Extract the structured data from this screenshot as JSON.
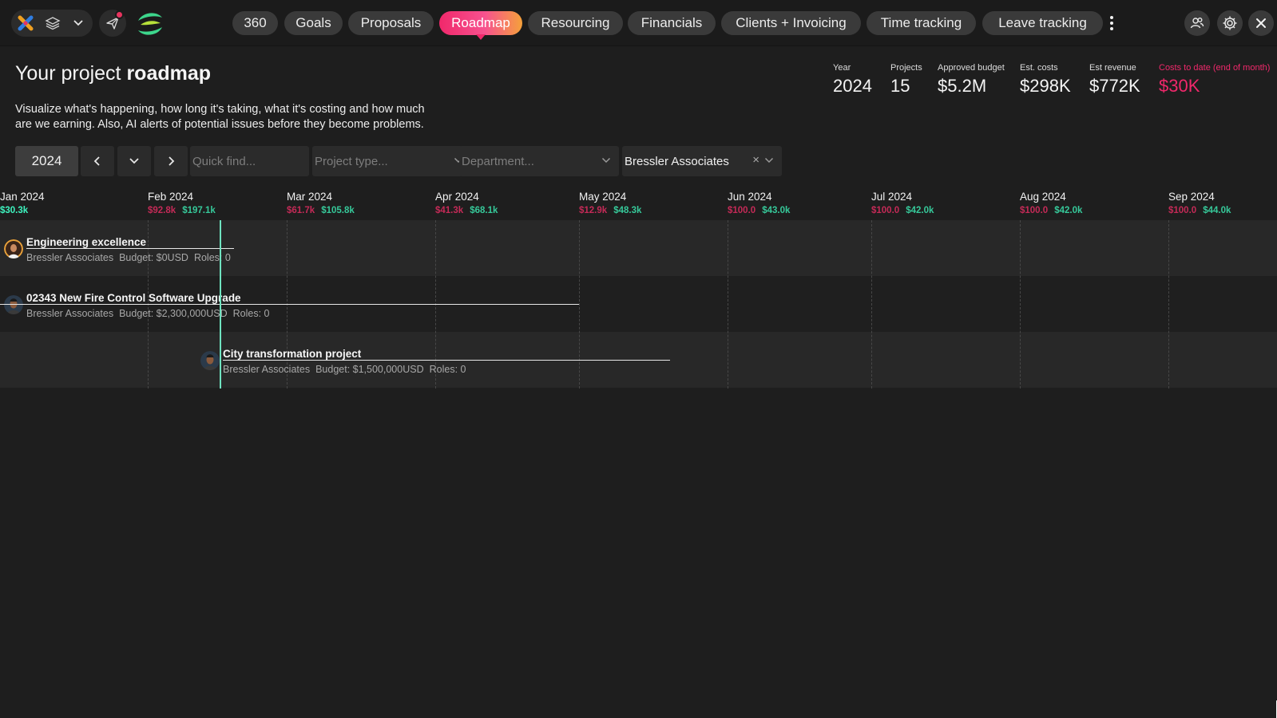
{
  "topbar": {
    "icons": {
      "app": "app-logo-icon",
      "layers": "layers-icon",
      "dropdown": "chevron-down-icon",
      "send": "send-icon",
      "brand": "brand-logo-icon",
      "more": "more-vertical-icon",
      "people": "people-icon",
      "settings": "gear-icon",
      "close": "close-icon"
    },
    "colors": {
      "notification": "#e8345f",
      "active_tab_start": "#f0286b",
      "active_tab_end": "#f5a13a",
      "brand_green": "#3dd68c"
    }
  },
  "nav": {
    "tabs": [
      {
        "label": "360"
      },
      {
        "label": "Goals"
      },
      {
        "label": "Proposals"
      },
      {
        "label": "Roadmap",
        "active": true
      },
      {
        "label": "Resourcing"
      },
      {
        "label": "Financials"
      },
      {
        "label": "Clients + Invoicing"
      },
      {
        "label": "Time tracking"
      },
      {
        "label": "Leave tracking"
      }
    ]
  },
  "header": {
    "title_normal": "Your project",
    "title_bold": "roadmap",
    "subtitle_line1": "Visualize what's happening, how long it's taking, what it's costing and how much",
    "subtitle_line2": "are we earning. Also, AI alerts of potential issues before they become problems."
  },
  "stats": [
    {
      "label": "Year",
      "value": "2024"
    },
    {
      "label": "Projects",
      "value": "15"
    },
    {
      "label": "Approved budget",
      "value": "$5.2M"
    },
    {
      "label": "Est. costs",
      "value": "$298K"
    },
    {
      "label": "Est revenue",
      "value": "$772K"
    },
    {
      "label": "Costs to date (end of month)",
      "value": "$30K"
    }
  ],
  "filters": {
    "year": "2024",
    "quick_find_placeholder": "Quick find...",
    "project_type_placeholder": "Project type...",
    "department_placeholder": "Department...",
    "client": "Bressler Associates",
    "clear_symbol": "×"
  },
  "timeline": {
    "months": [
      {
        "name": "Jan 2024",
        "cost": "",
        "revenue": "$30.3k"
      },
      {
        "name": "Feb 2024",
        "cost": "$92.8k",
        "revenue": "$197.1k"
      },
      {
        "name": "Mar 2024",
        "cost": "$61.7k",
        "revenue": "$105.8k"
      },
      {
        "name": "Apr 2024",
        "cost": "$41.3k",
        "revenue": "$68.1k"
      },
      {
        "name": "May 2024",
        "cost": "$12.9k",
        "revenue": "$48.3k"
      },
      {
        "name": "Jun 2024",
        "cost": "$100.0",
        "revenue": "$43.0k"
      },
      {
        "name": "Jul 2024",
        "cost": "$100.0",
        "revenue": "$42.0k"
      },
      {
        "name": "Aug 2024",
        "cost": "$100.0",
        "revenue": "$42.0k"
      },
      {
        "name": "Sep 2024",
        "cost": "$100.0",
        "revenue": "$44.0k"
      }
    ],
    "colors": {
      "cost": "#c42a57",
      "revenue": "#36c99a",
      "today_line": "#6fe3c0"
    },
    "projects": [
      {
        "name": "Engineering excellence",
        "client": "Bressler Associates",
        "budget": "Budget: $0USD",
        "roles": "Roles: 0",
        "avatar": "avatar-woman"
      },
      {
        "name": "02343 New Fire Control Software Upgrade",
        "client": "Bressler Associates",
        "budget": "Budget: $2,300,000USD",
        "roles": "Roles: 0",
        "avatar": "avatar-man"
      },
      {
        "name": "City transformation project",
        "client": "Bressler Associates",
        "budget": "Budget: $1,500,000USD",
        "roles": "Roles: 0",
        "avatar": "avatar-man"
      }
    ]
  }
}
